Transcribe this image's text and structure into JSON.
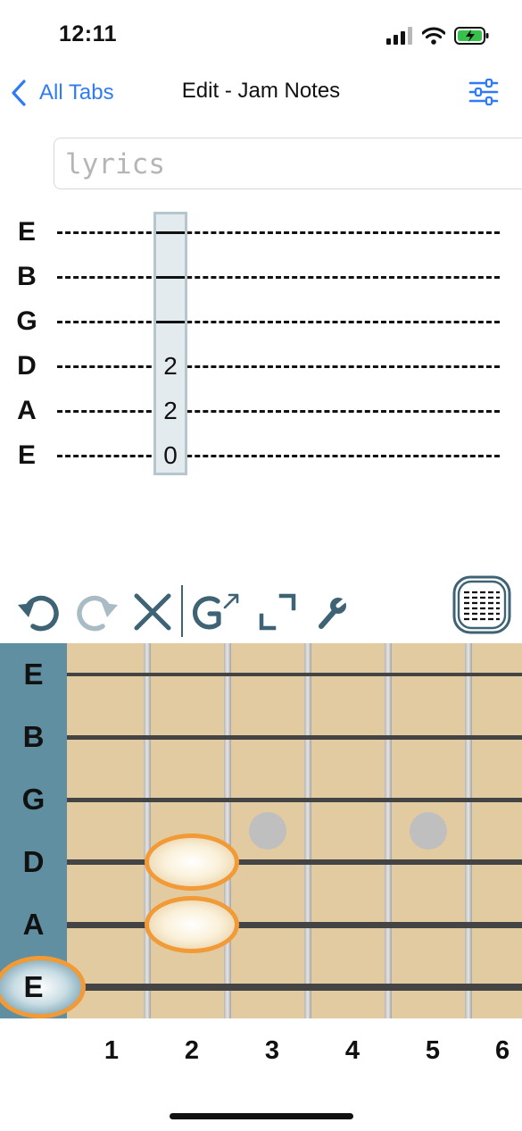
{
  "status_bar": {
    "time": "12:11"
  },
  "nav": {
    "back_label": "All Tabs",
    "title": "Edit - Jam Notes"
  },
  "lyrics": {
    "placeholder": "lyrics"
  },
  "tab": {
    "strings": [
      "E",
      "B",
      "G",
      "D",
      "A",
      "E"
    ],
    "selected_column_frets": [
      "",
      "",
      "",
      "2",
      "2",
      "0"
    ]
  },
  "toolbar": {
    "icons": [
      "undo-icon",
      "redo-icon",
      "clear-icon",
      "chord-icon",
      "expand-icon",
      "wrench-icon",
      "tab-view-icon"
    ]
  },
  "fretboard": {
    "strings": [
      "E",
      "B",
      "G",
      "D",
      "A",
      "E"
    ],
    "fret_numbers": [
      "1",
      "2",
      "3",
      "4",
      "5",
      "6"
    ],
    "pressed_notes": [
      {
        "string": "D",
        "fret": 2
      },
      {
        "string": "A",
        "fret": 2
      },
      {
        "string": "E",
        "fret": 0
      }
    ]
  },
  "colors": {
    "accent": "#2f7bf6",
    "nut_panel": "#5f8fa1",
    "fretboard": "#e2cba0",
    "highlight_ring": "#f29a36",
    "icon": "#3d6374"
  }
}
